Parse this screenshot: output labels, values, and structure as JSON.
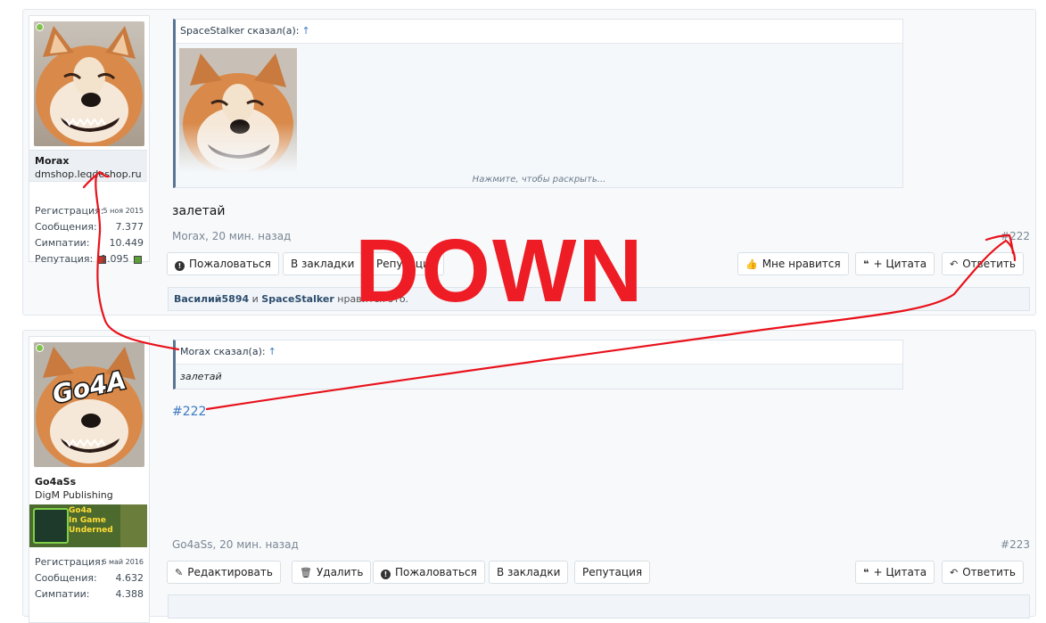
{
  "post1": {
    "user": {
      "name": "Morax",
      "title": "dmshop.leqdeshop.ru",
      "online": true,
      "stats": [
        {
          "label": "Регистрация:",
          "value": "5 ноя 2015"
        },
        {
          "label": "Сообщения:",
          "value": "7.377"
        },
        {
          "label": "Симпатии:",
          "value": "10.449"
        },
        {
          "label": "Репутация:",
          "value": "1.095"
        }
      ]
    },
    "quote": {
      "author": "SpaceStalker сказал(а):",
      "arrow": "↑",
      "expand": "Нажмите, чтобы раскрыть..."
    },
    "message": "залетай",
    "meta": "Morax, 20 мин. назад",
    "permalink": "#222",
    "buttons": {
      "report": "Пожаловаться",
      "bookmark": "В закладки",
      "reputation": "Репутация",
      "like": "Мне нравится",
      "quote": "+ Цитата",
      "reply": "Ответить"
    },
    "likes": {
      "user1": "Василий5894",
      "and": "и",
      "user2": "SpaceStalker",
      "suffix": "нравится это."
    }
  },
  "post2": {
    "user": {
      "name": "Go4aSs",
      "title": "DigM Publishing",
      "online": true,
      "avatar_text": "Go4A",
      "banner_text": [
        "Go4a",
        "In Game",
        "Underned"
      ],
      "stats": [
        {
          "label": "Регистрация:",
          "value": "6 май 2016"
        },
        {
          "label": "Сообщения:",
          "value": "4.632"
        },
        {
          "label": "Симпатии:",
          "value": "4.388"
        }
      ]
    },
    "quote": {
      "author": "Morax сказал(а):",
      "arrow": "↑",
      "text": "залетай"
    },
    "message_link": "#222",
    "meta": "Go4aSs, 20 мин. назад",
    "permalink": "#223",
    "buttons": {
      "edit": "Редактировать",
      "delete": "Удалить",
      "report": "Пожаловаться",
      "bookmark": "В закладки",
      "reputation": "Репутация",
      "quote": "+ Цитата",
      "reply": "Ответить"
    }
  },
  "annotation": {
    "text": "DOWN",
    "color": "#ee1c24"
  },
  "colors": {
    "link": "#3d79c0",
    "online": "#7fc24c",
    "quote_border": "#5a7591"
  }
}
